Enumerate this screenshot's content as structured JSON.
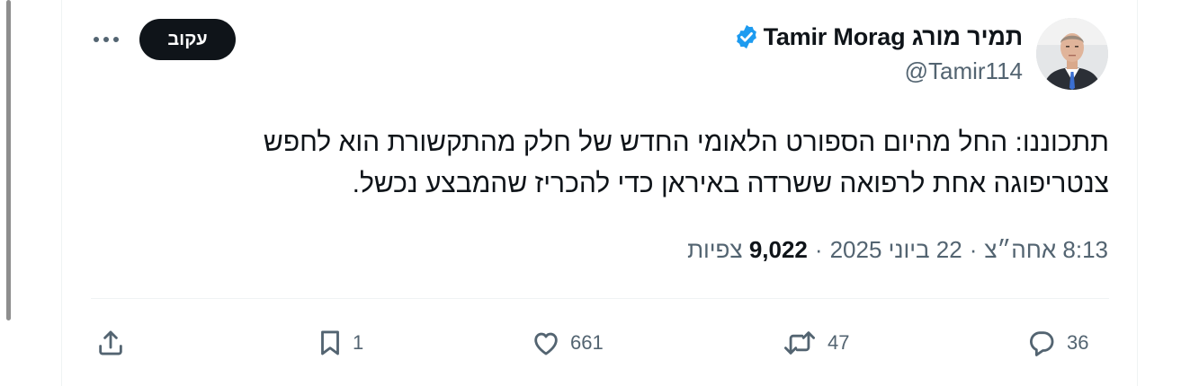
{
  "author": {
    "name": "Tamir Morag תמיר מורג",
    "handle": "@Tamir114",
    "verified": true
  },
  "follow_button": {
    "label": "עקוב"
  },
  "more_menu": {
    "icon": "more-horizontal-icon"
  },
  "tweet": {
    "text_line1": "תתכוננו: החל מהיום הספורט הלאומי החדש של חלק מהתקשורת הוא לחפש",
    "text_line2": "צנטריפוגה אחת לרפואה ששרדה באיראן כדי להכריז שהמבצע נכשל."
  },
  "meta": {
    "time": "8:13 אחה״צ",
    "date": "22 ביוני 2025",
    "separator": "·",
    "views_count": "9,022",
    "views_label": "צפיות"
  },
  "actions": {
    "replies": {
      "icon": "reply-icon",
      "count": "36"
    },
    "retweets": {
      "icon": "retweet-icon",
      "count": "47"
    },
    "likes": {
      "icon": "heart-icon",
      "count": "661"
    },
    "bookmarks": {
      "icon": "bookmark-icon",
      "count": "1"
    },
    "share": {
      "icon": "share-icon"
    }
  },
  "colors": {
    "text_primary": "#0f1419",
    "text_secondary": "#536471",
    "verified_blue": "#1d9bf0",
    "divider": "#eff3f4"
  }
}
